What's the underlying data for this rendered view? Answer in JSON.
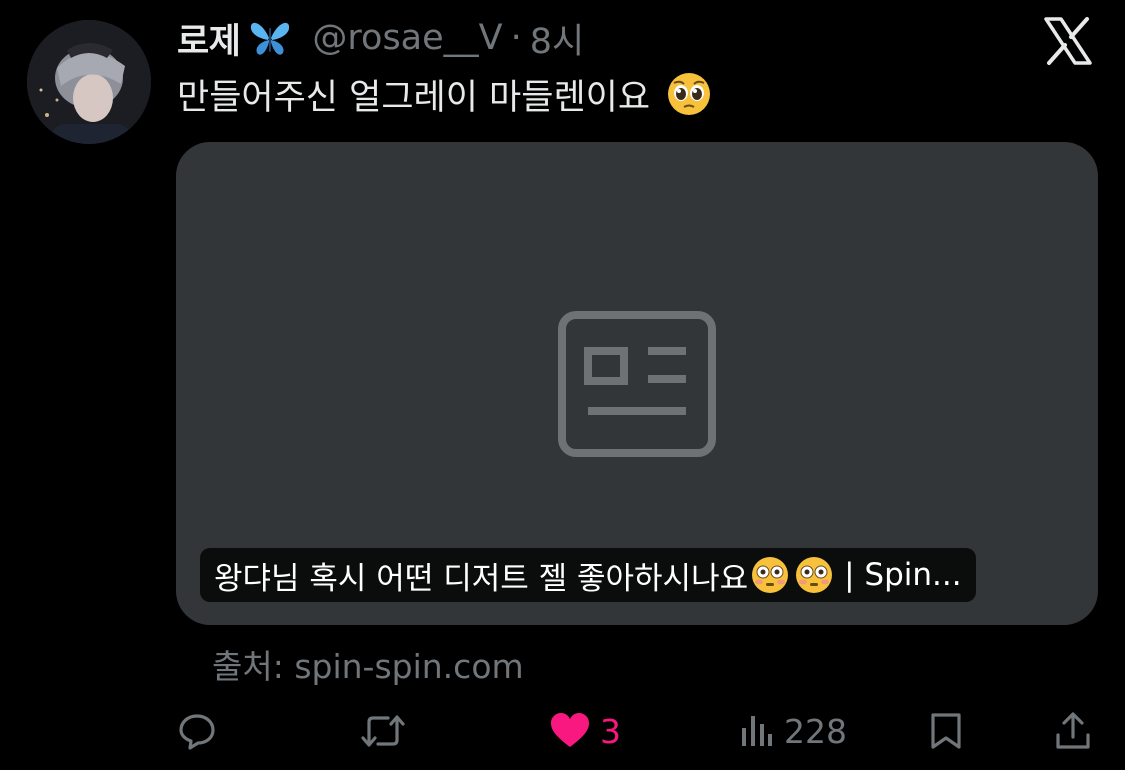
{
  "tweet": {
    "display_name": "로제",
    "name_emoji": "butterfly-icon",
    "handle": "@rosae__V",
    "separator": "·",
    "time": "8시",
    "text": "만들어주신 얼그레이 마들렌이요",
    "text_emoji": "pleading-face-emoji"
  },
  "card": {
    "icon": "article-icon",
    "title_part1": "왕댜님 혹시 어떤 디저트 젤 좋아하시나요",
    "title_emoji": "flushed-face-emoji",
    "title_tail": "| Spin...",
    "source": "출처: spin-spin.com"
  },
  "actions": {
    "reply_icon": "reply-icon",
    "retweet_icon": "retweet-icon",
    "like_icon": "heart-icon",
    "like_count": "3",
    "views_icon": "views-icon",
    "views_count": "228",
    "bookmark_icon": "bookmark-icon",
    "share_icon": "share-icon"
  },
  "brand": {
    "logo": "x-logo",
    "like_color": "#f91880",
    "muted_color": "#71767b",
    "card_color": "#333639"
  }
}
